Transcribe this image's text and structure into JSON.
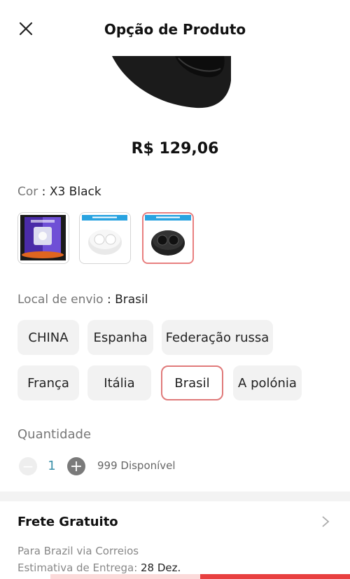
{
  "header": {
    "title": "Opção de Produto",
    "close_icon": "close-icon"
  },
  "product": {
    "price": "R$ 129,06"
  },
  "color": {
    "label": "Cor",
    "separator": " : ",
    "selected": "X3 Black",
    "thumbs": [
      {
        "name": "box-package",
        "text": "EDIFIER"
      },
      {
        "name": "X3 White",
        "text": "EDIFIER X3 WHITE"
      },
      {
        "name": "X3 Black",
        "text": "EDIFIER X3 BLACK"
      }
    ]
  },
  "shipping_from": {
    "label": "Local de envio",
    "separator": " : ",
    "selected": "Brasil",
    "options": [
      "CHINA",
      "Espanha",
      "Federação russa",
      "França",
      "Itália",
      "Brasil",
      "A polónia"
    ]
  },
  "quantity": {
    "label": "Quantidade",
    "value": "1",
    "minus": "−",
    "plus": "+",
    "available": "999 Disponível"
  },
  "shipping": {
    "title": "Frete Gratuito",
    "line1": "Para Brazil via Correios",
    "line2_label": "Estimativa de Entrega:",
    "line2_value": " 28 Dez."
  },
  "colors": {
    "accent": "#e84040",
    "selected_border": "#e07a7a",
    "chip_bg": "#f2f2f2"
  }
}
